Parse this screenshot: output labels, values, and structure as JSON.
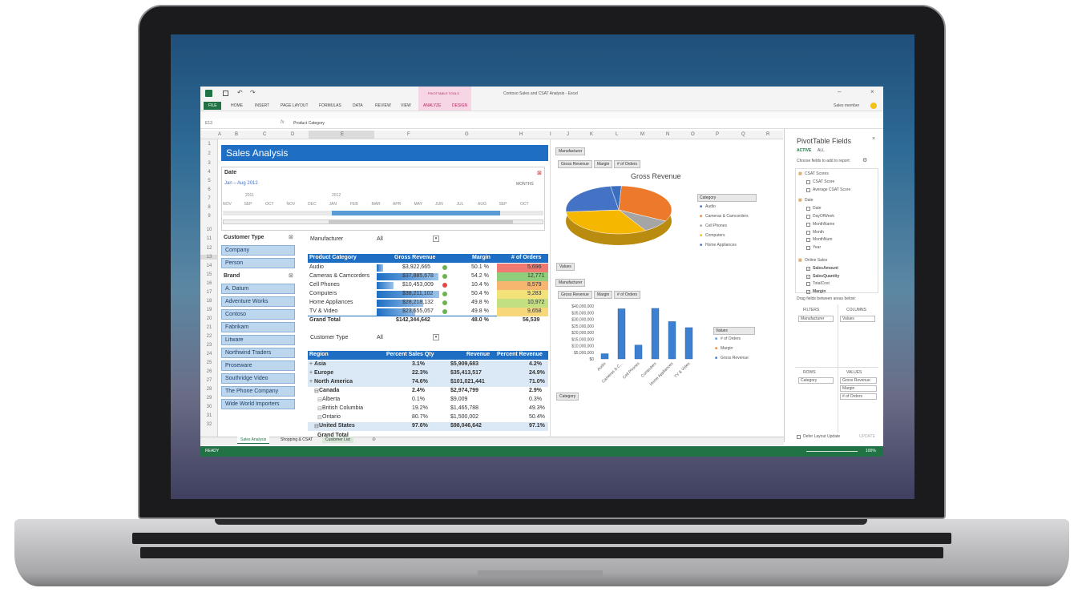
{
  "ribbon": {
    "tool_label": "PIVOTTABLE TOOLS",
    "title": "Contoso Sales and CSAT Analysis - Excel",
    "user": "Sales member",
    "tabs": [
      "FILE",
      "HOME",
      "INSERT",
      "PAGE LAYOUT",
      "FORMULAS",
      "DATA",
      "REVIEW",
      "VIEW",
      "ANALYZE",
      "DESIGN"
    ]
  },
  "formula": {
    "cell": "E13",
    "content": "Product Category"
  },
  "columns": [
    "A",
    "B",
    "C",
    "D",
    "E",
    "F",
    "G",
    "H",
    "I",
    "J",
    "K",
    "L",
    "M",
    "N",
    "O",
    "P",
    "Q",
    "R"
  ],
  "rows": [
    "1",
    "2",
    "3",
    "4",
    "5",
    "6",
    "7",
    "8",
    "9",
    "10",
    "11",
    "12",
    "13",
    "14",
    "15",
    "16",
    "17",
    "18",
    "19",
    "20",
    "21",
    "22",
    "23",
    "24",
    "25",
    "26",
    "27",
    "28",
    "29",
    "30",
    "31",
    "32"
  ],
  "sheet_title": "Sales Analysis",
  "timeline": {
    "label": "Date",
    "range": "Jan – Aug 2012",
    "unit": "MONTHS",
    "years": [
      "2011",
      "2012"
    ],
    "months": [
      "NOV",
      "SEP",
      "OCT",
      "NOV",
      "DEC",
      "JAN",
      "FEB",
      "MAR",
      "APR",
      "MAY",
      "JUN",
      "JUL",
      "AUG",
      "SEP",
      "OCT"
    ]
  },
  "slicer_customer": {
    "title": "Customer Type",
    "items": [
      "Company",
      "Person"
    ]
  },
  "slicer_brand": {
    "title": "Brand",
    "items": [
      "A. Datum",
      "Adventure Works",
      "Contoso",
      "Fabrikam",
      "Litware",
      "Northwind Traders",
      "Proseware",
      "Southridge Video",
      "The Phone Company",
      "Wide World Importers"
    ]
  },
  "pivot1": {
    "filter_label": "Manufacturer",
    "filter_value": "All",
    "headers": [
      "Product Category",
      "Gross Revenue",
      "Margin",
      "# of Orders"
    ],
    "rows": [
      [
        "Audio",
        "$3,922,665",
        "50.1 %",
        "5,696"
      ],
      [
        "Cameras & Camcorders",
        "$37,885,678",
        "54.2 %",
        "12,771"
      ],
      [
        "Cell Phones",
        "$10,453,009",
        "10.4 %",
        "8,579"
      ],
      [
        "Computers",
        "$38,211,102",
        "50.4 %",
        "9,283"
      ],
      [
        "Home Appliances",
        "$28,218,132",
        "49.8 %",
        "10,972"
      ],
      [
        "TV & Video",
        "$23,655,057",
        "49.8 %",
        "9,658"
      ]
    ],
    "total": [
      "Grand Total",
      "$142,344,642",
      "48.0 %",
      "56,539"
    ],
    "orders_colors": [
      "#f07a72",
      "#8fcf7c",
      "#f6b66f",
      "#f3e27a",
      "#c2df82",
      "#f6d77a"
    ],
    "bar_fill": [
      0.1,
      0.99,
      0.27,
      1.0,
      0.74,
      0.62
    ]
  },
  "pivot2": {
    "filter_label": "Customer Type",
    "filter_value": "All",
    "headers": [
      "Region",
      "Percent Sales Qty",
      "Revenue",
      "Percent Revenue"
    ],
    "rows": [
      [
        "Asia",
        "3.1%",
        "$5,909,683",
        "4.2%"
      ],
      [
        "Europe",
        "22.3%",
        "$35,413,517",
        "24.9%"
      ],
      [
        "North America",
        "74.6%",
        "$101,021,441",
        "71.0%"
      ],
      [
        "Canada",
        "2.4%",
        "$2,974,799",
        "2.9%"
      ],
      [
        "Alberta",
        "0.1%",
        "$9,009",
        "0.3%"
      ],
      [
        "British Columbia",
        "19.2%",
        "$1,465,788",
        "49.3%"
      ],
      [
        "Ontario",
        "80.7%",
        "$1,500,002",
        "50.4%"
      ],
      [
        "United States",
        "97.6%",
        "$98,046,642",
        "97.1%"
      ]
    ],
    "last_row": "Grand Total"
  },
  "chart_buttons": {
    "manufacturer": "Manufacturer",
    "gross": "Gross Revenue",
    "margin": "Margin",
    "orders": "# of Orders",
    "values": "Values",
    "category": "Category"
  },
  "chart_data": [
    {
      "type": "pie",
      "title": "Gross Revenue",
      "legend_title": "Category",
      "categories": [
        "Audio",
        "Cameras & Camcorders",
        "Cell Phones",
        "Computers",
        "Home Appliances"
      ],
      "values": [
        3922665,
        37885678,
        10453009,
        38211102,
        28218132
      ],
      "colors": [
        "#3a6fc0",
        "#ec7a2a",
        "#a5a5a5",
        "#f5b700",
        "#4472c4"
      ]
    },
    {
      "type": "bar",
      "categories": [
        "Audio",
        "Cameras & C...",
        "Cell Phones",
        "Computers",
        "Home Appliances",
        "TV & Video"
      ],
      "series": [
        {
          "name": "Gross Revenue",
          "values": [
            3922665,
            37885678,
            10453009,
            38211102,
            28218132,
            23655057
          ]
        }
      ],
      "ylim": [
        0,
        40000000
      ],
      "yticks": [
        "$40,000,000",
        "$35,000,000",
        "$30,000,000",
        "$25,000,000",
        "$20,000,000",
        "$15,000,000",
        "$10,000,000",
        "$5,000,000",
        "$0"
      ],
      "legend_title": "Values",
      "legend": [
        "# of Orders",
        "Margin",
        "Gross Revenue"
      ],
      "legend_colors": [
        "#5b9bd5",
        "#ed7d31",
        "#4472c4"
      ]
    }
  ],
  "fields": {
    "title": "PivotTable Fields",
    "tabs": [
      "ACTIVE",
      "ALL"
    ],
    "prompt": "Choose fields to add to report:",
    "items": [
      "CSAT Scores",
      "CSAT Score",
      "Average CSAT Score",
      "Date",
      "Date",
      "DayOfWeek",
      "MonthName",
      "Month",
      "MonthNum",
      "Year",
      "Online Sales",
      "SalesAmount",
      "SalesQuantity",
      "TotalCost",
      "Margin"
    ],
    "areas_prompt": "Drag fields between areas below:",
    "filters": "FILTERS",
    "columns": "COLUMNS",
    "rows": "ROWS",
    "values": "VALUES",
    "filter_value": "Manufacturer",
    "column_value": "Values",
    "row_value": "Category",
    "value_items": [
      "Gross Revenue",
      "Margin",
      "# of Orders"
    ],
    "defer": "Defer Layout Update",
    "update": "UPDATE"
  },
  "sheets": [
    "Sales Analysis",
    "Shopping & CSAT",
    "Customer List"
  ],
  "status": {
    "ready": "READY",
    "zoom": "100%"
  }
}
